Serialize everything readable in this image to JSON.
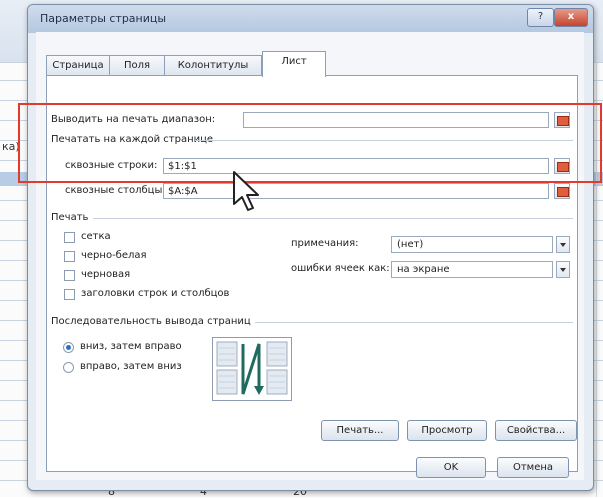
{
  "dialog": {
    "title": "Параметры страницы",
    "help_label": "?",
    "close_label": "x"
  },
  "tabs": [
    {
      "label": "Страница"
    },
    {
      "label": "Поля"
    },
    {
      "label": "Колонтитулы"
    },
    {
      "label": "Лист",
      "active": true
    }
  ],
  "print_area": {
    "label": "Выводить на печать диапазон:",
    "value": ""
  },
  "print_titles": {
    "title": "Печатать на каждой странице",
    "rows_label": "сквозные строки:",
    "rows_value": "$1:$1",
    "cols_label": "сквозные столбцы:",
    "cols_value": "$A:$A"
  },
  "print": {
    "title": "Печать",
    "checkboxes": [
      {
        "label": "сетка",
        "checked": false
      },
      {
        "label": "черно-белая",
        "checked": false
      },
      {
        "label": "черновая",
        "checked": false
      },
      {
        "label": "заголовки строк и столбцов",
        "checked": false
      }
    ],
    "comments_label": "примечания:",
    "comments_value": "(нет)",
    "errors_label": "ошибки ячеек как:",
    "errors_value": "на экране"
  },
  "page_order": {
    "title": "Последовательность вывода страниц",
    "options": [
      {
        "label": "вниз, затем вправо",
        "selected": true
      },
      {
        "label": "вправо, затем вниз",
        "selected": false
      }
    ]
  },
  "buttons": {
    "print": "Печать...",
    "preview": "Просмотр",
    "properties": "Свойства...",
    "ok": "OK",
    "cancel": "Отмена"
  },
  "background": {
    "left_fragment": "ка)",
    "bottom_numbers": [
      "8",
      "4",
      "20"
    ]
  },
  "colors": {
    "highlight_frame": "#e23b2e",
    "accent": "#2d6fc1"
  }
}
